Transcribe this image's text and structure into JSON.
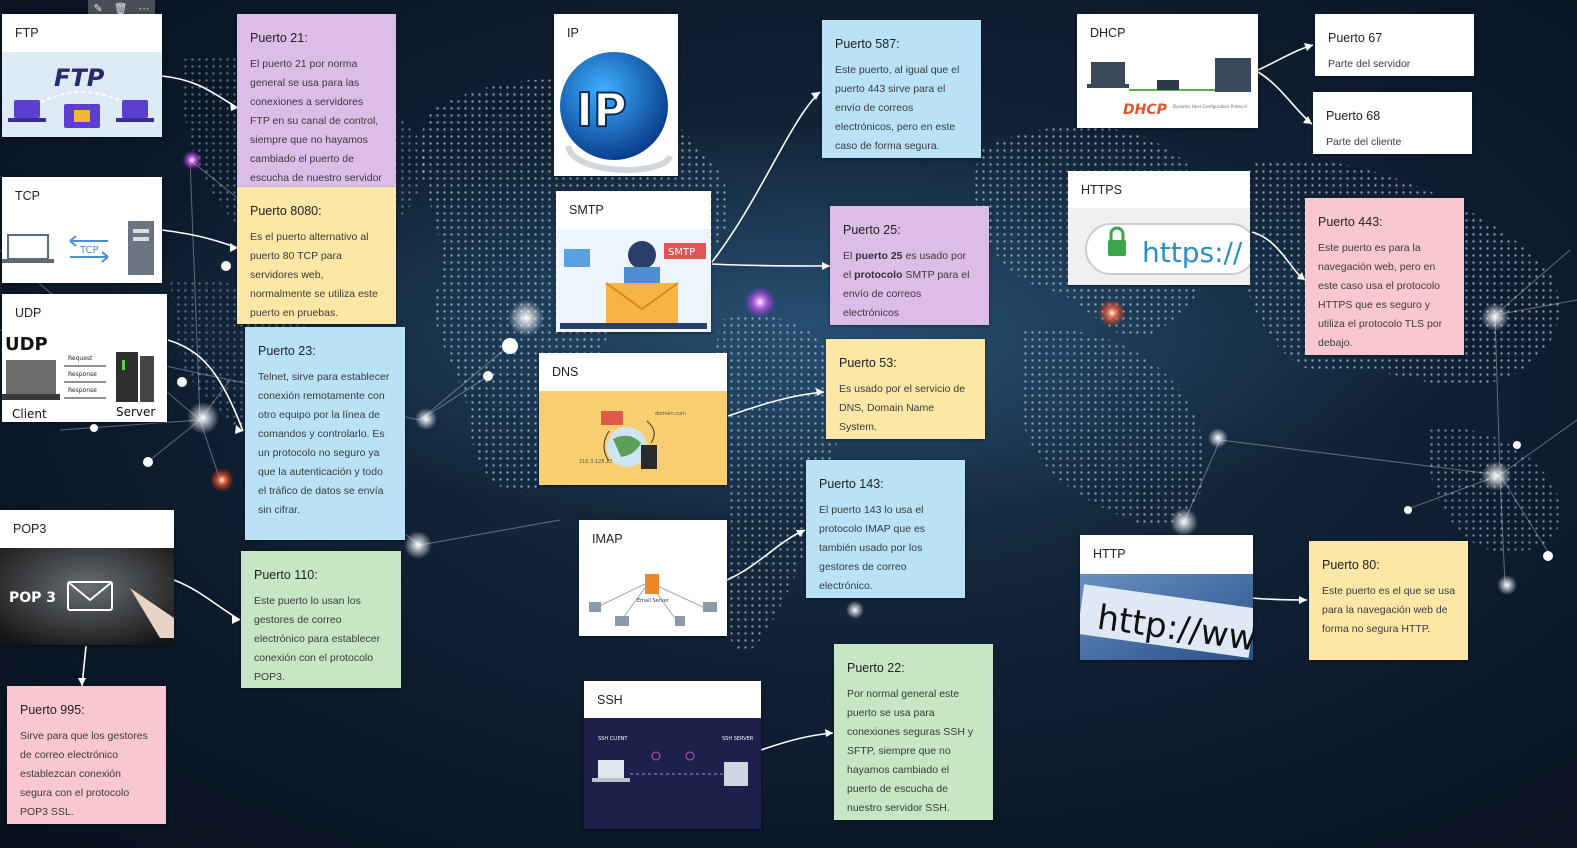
{
  "toolbar": {
    "edit_icon": "pencil-icon",
    "delete_icon": "trash-icon",
    "more_icon": "ellipsis-icon"
  },
  "cards": {
    "ftp": {
      "title": "FTP",
      "art": "FTP"
    },
    "tcp": {
      "title": "TCP",
      "art": "TCP"
    },
    "udp": {
      "title": "UDP",
      "art": "UDP",
      "art_request": "Request",
      "art_response": "Response",
      "art_client": "Client",
      "art_server": "Server"
    },
    "pop3": {
      "title": "POP3",
      "art": "POP 3"
    },
    "ip": {
      "title": "IP",
      "art": "IP"
    },
    "smtp": {
      "title": "SMTP",
      "art": "SMTP"
    },
    "dns": {
      "title": "DNS",
      "art_domain": "domain.com",
      "art_ip": "216.3.128.12"
    },
    "imap": {
      "title": "IMAP",
      "art": "Email Server"
    },
    "ssh": {
      "title": "SSH",
      "art_client": "SSH CLIENT",
      "art_server": "SSH SERVER"
    },
    "dhcp": {
      "title": "DHCP",
      "art": "DHCP",
      "art_sub": "Dynamic Host Configuration Protocol"
    },
    "https": {
      "title": "HTTPS",
      "art": "https://"
    },
    "http": {
      "title": "HTTP",
      "art": "http://ww"
    }
  },
  "notes": {
    "p21": {
      "head": "Puerto 21:",
      "body": "El puerto 21 por norma general se usa para las conexiones a servidores FTP en su canal de control, siempre que no hayamos cambiado el puerto de escucha de nuestro servidor FTP o FTPES."
    },
    "p8080": {
      "head": "Puerto 8080:",
      "body": "Es el puerto alternativo al puerto 80 TCP para servidores web, normalmente se utiliza este puerto en pruebas."
    },
    "p23": {
      "head": "Puerto 23:",
      "body": "Telnet, sirve para establecer conexión remotamente con otro equipo por la línea de comandos y controlarlo. Es un protocolo no seguro ya que la autenticación y todo el tráfico de datos se envía sin cifrar."
    },
    "p110": {
      "head": "Puerto 110:",
      "body": "Este puerto lo usan los gestores de correo electrónico para establecer conexión con el protocolo POP3."
    },
    "p995": {
      "head": "Puerto 995:",
      "body": "Sirve para que los gestores de correo electrónico establezcan conexión segura con el protocolo POP3 SSL."
    },
    "p587": {
      "head": "Puerto 587:",
      "body": "Este puerto, al igual que el puerto 443 sirve para el envío de correos electrónicos, pero en este caso de forma segura."
    },
    "p25": {
      "head": "Puerto 25:",
      "body_a": " El ",
      "body_b": "puerto 25",
      "body_c": " es usado por el ",
      "body_d": "protocolo",
      "body_e": " SMTP para el envío de correos electrónicos"
    },
    "p53": {
      "head": "Puerto 53:",
      "body": "Es usado por el servicio de DNS, Domain Name System."
    },
    "p143": {
      "head": "Puerto 143:",
      "body": "El puerto 143 lo usa el protocolo IMAP que es también usado por los gestores de correo electrónico."
    },
    "p22": {
      "head": "Puerto 22:",
      "body": "Por normal general este puerto se usa para conexiones seguras SSH y SFTP, siempre que no hayamos cambiado el puerto de escucha de nuestro servidor SSH."
    },
    "p67": {
      "head": "Puerto 67",
      "body": "Parte del servidor"
    },
    "p68": {
      "head": "Puerto 68",
      "body": "Parte del cliente"
    },
    "p443": {
      "head": "Puerto 443:",
      "body": "Este puerto es para la navegación web, pero en este caso usa el protocolo HTTPS que es seguro y utiliza el protocolo TLS por debajo."
    },
    "p80": {
      "head": "Puerto 80:",
      "body": "Este puerto es el que se usa para la navegación web de forma no segura HTTP."
    }
  },
  "colors": {
    "purple": "#dcbde8",
    "yellow": "#fde7a6",
    "blue": "#b9e2f7",
    "green": "#c6e6c4",
    "pink": "#f9c7d0",
    "background": "#112236"
  }
}
